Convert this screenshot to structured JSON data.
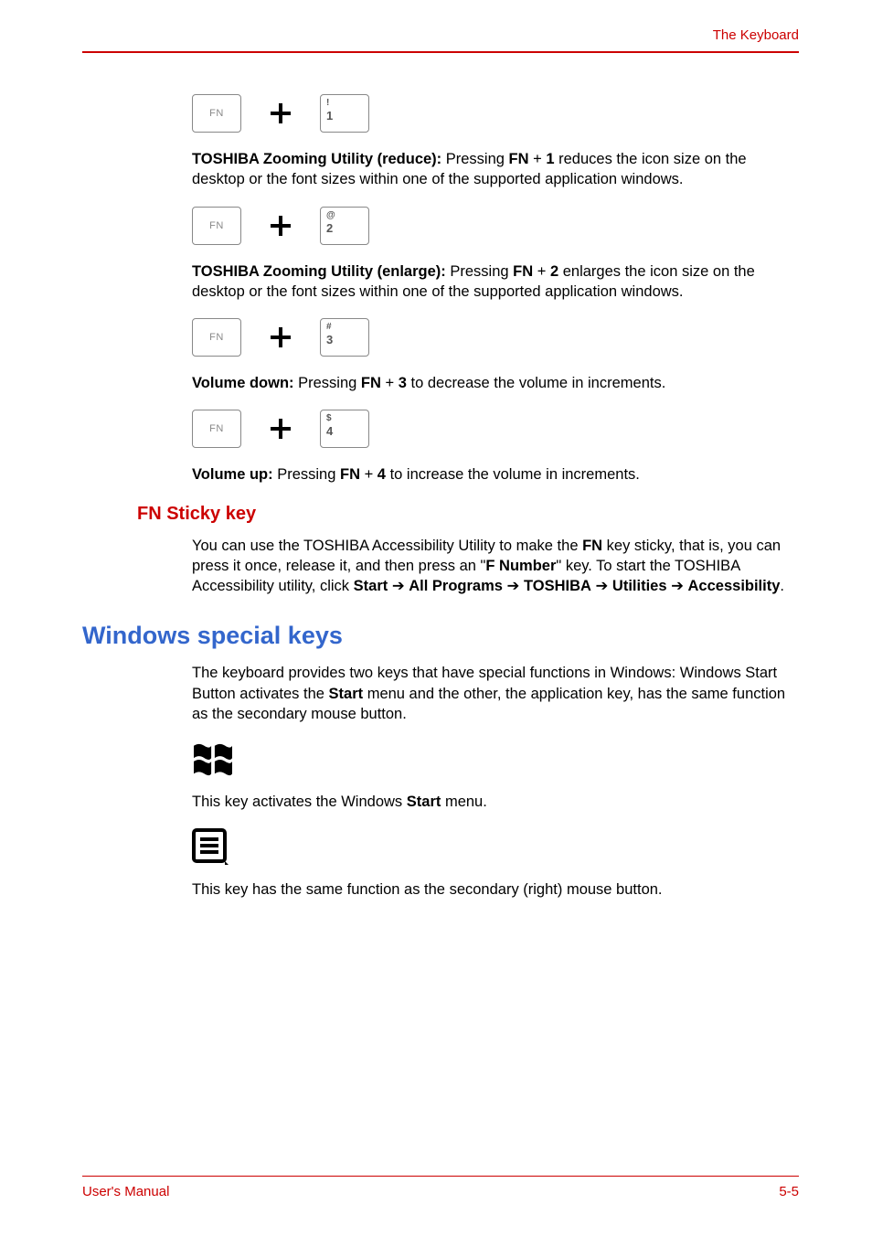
{
  "header": {
    "right": "The Keyboard"
  },
  "key_labels": {
    "fn": "FN",
    "k1_top": "!",
    "k1_mid": "1",
    "k1_sub": "",
    "k2_top": "@",
    "k2_mid": "2",
    "k2_sub": "",
    "k3_top": "#",
    "k3_mid": "3",
    "k3_sub": "",
    "k4_top": "$",
    "k4_mid": "4",
    "k4_sub": ""
  },
  "p1": {
    "bold1": "TOSHIBA Zooming Utility (reduce):",
    "t1": " Pressing ",
    "bold2": "FN",
    "t2": " + ",
    "bold3": "1",
    "t3": " reduces the icon size on the desktop or the font sizes within one of the supported application windows."
  },
  "p2": {
    "bold1": "TOSHIBA Zooming Utility (enlarge):",
    "t1": " Pressing ",
    "bold2": "FN",
    "t2": " + ",
    "bold3": "2",
    "t3": " enlarges the icon size on the desktop or the font sizes within one of the supported application windows."
  },
  "p3": {
    "bold1": "Volume down:",
    "t1": " Pressing ",
    "bold2": "FN",
    "t2": " + ",
    "bold3": "3",
    "t3": " to decrease the volume in increments."
  },
  "p4": {
    "bold1": "Volume up:",
    "t1": " Pressing ",
    "bold2": "FN",
    "t2": " + ",
    "bold3": "4",
    "t3": " to increase the volume in increments."
  },
  "h3": "FN Sticky key",
  "p5": {
    "t1": "You can use the TOSHIBA Accessibility Utility to make the ",
    "b1": "FN",
    "t2": " key sticky, that is, you can press it once, release it, and then press an \"",
    "b2": "F Number",
    "t3": "\" key. To start the TOSHIBA Accessibility utility, click ",
    "b3": "Start",
    "arrow1": " ➔ ",
    "b4": "All Programs",
    "arrow2": " ➔ ",
    "b5": "TOSHIBA",
    "arrow3": " ➔ ",
    "b6": "Utilities",
    "arrow4": " ➔ ",
    "b7": "Accessibility",
    "t4": "."
  },
  "h2": "Windows special keys",
  "p6": {
    "t1": "The keyboard provides two keys that have special functions in Windows: Windows Start Button activates the ",
    "b1": "Start",
    "t2": " menu and the other, the application key, has the same function as the secondary mouse button."
  },
  "p7": {
    "t1": "This key activates the Windows ",
    "b1": "Start",
    "t2": " menu."
  },
  "p8": {
    "t1": "This key has the same function as the secondary (right) mouse button."
  },
  "footer": {
    "left": "User's Manual",
    "right": "5-5"
  }
}
